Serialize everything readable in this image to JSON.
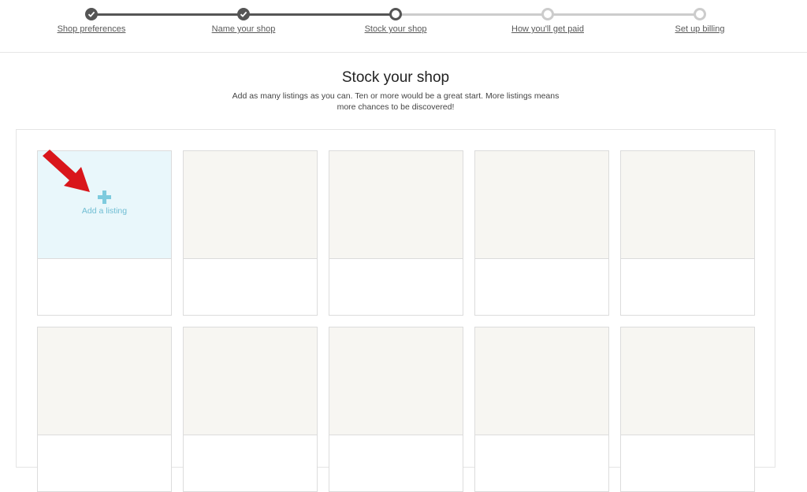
{
  "progress": {
    "steps": [
      {
        "label": "Shop preferences",
        "state": "completed"
      },
      {
        "label": "Name your shop",
        "state": "completed"
      },
      {
        "label": "Stock your shop",
        "state": "current"
      },
      {
        "label": "How you'll get paid",
        "state": "upcoming"
      },
      {
        "label": "Set up billing",
        "state": "upcoming"
      }
    ],
    "completed_color": "#555555",
    "upcoming_color": "#cccccc"
  },
  "main": {
    "title": "Stock your shop",
    "subtitle": "Add as many listings as you can. Ten or more would be a great start. More listings means more chances to be discovered!"
  },
  "grid": {
    "add_card": {
      "label": "Add a listing",
      "icon": "plus-icon",
      "accent": "#7ecbde"
    },
    "placeholder_count": 9
  },
  "annotation": {
    "icon": "red-arrow-icon",
    "color": "#d9161b"
  }
}
